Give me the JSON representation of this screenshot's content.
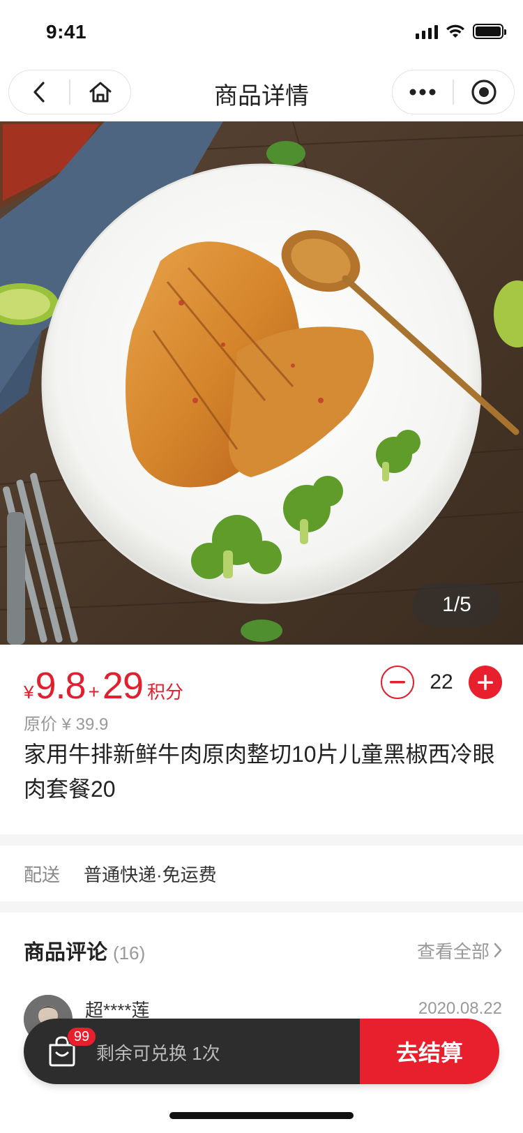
{
  "status_bar": {
    "time": "9:41"
  },
  "nav": {
    "title": "商品详情"
  },
  "gallery": {
    "pager": "1/5"
  },
  "product": {
    "currency": "¥",
    "price": "9.8",
    "plus": "+",
    "points": "29",
    "points_unit": "积分",
    "quantity": "22",
    "original_price": "原价 ¥ 39.9",
    "title": "家用牛排新鲜牛肉原肉整切10片儿童黑椒西冷眼肉套餐20"
  },
  "delivery": {
    "label": "配送",
    "value": "普通快递·免运费"
  },
  "reviews": {
    "title": "商品评论",
    "count": "(16)",
    "view_all": "查看全部",
    "items": [
      {
        "user": "超****莲",
        "date": "2020.08.22"
      }
    ]
  },
  "checkout": {
    "badge": "99",
    "remaining": "剩余可兑换 1次",
    "button": "去结算"
  },
  "colors": {
    "accent": "#e8202e",
    "bar_dark": "#2d2d2d"
  }
}
